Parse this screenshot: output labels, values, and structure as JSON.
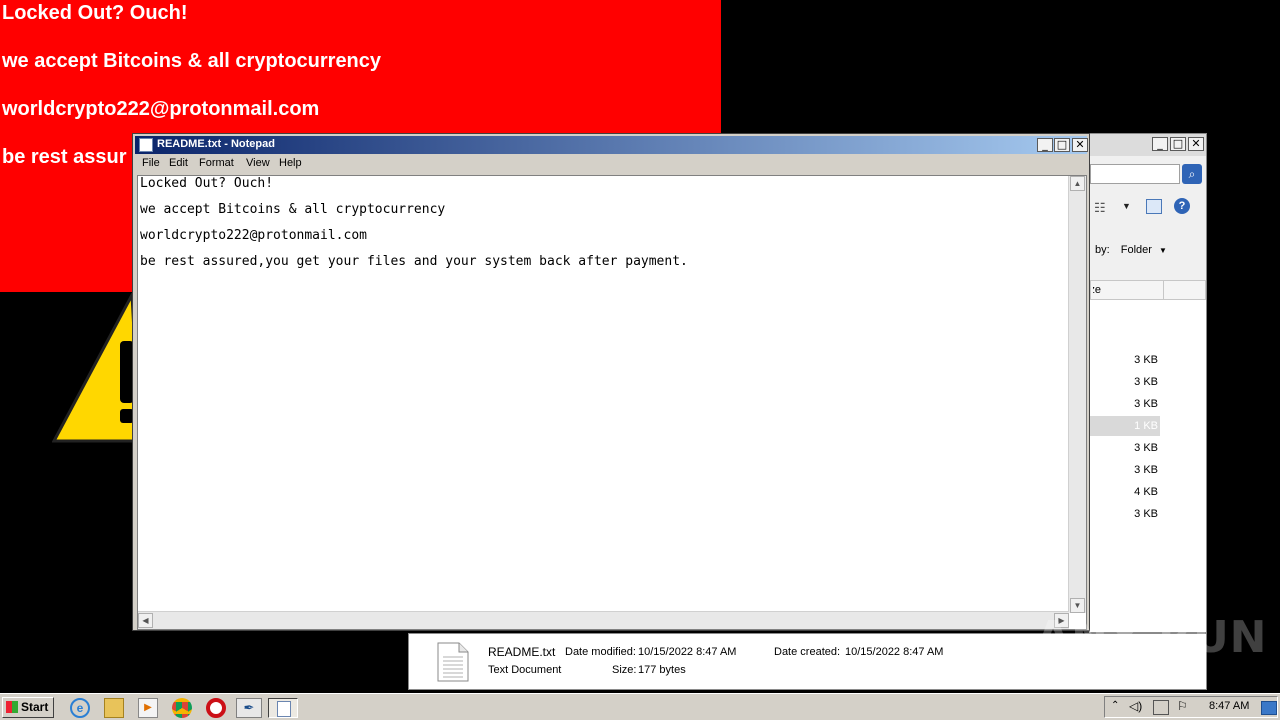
{
  "wallpaper": {
    "lines": [
      "Locked Out? Ouch!",
      "we accept Bitcoins & all cryptocurrency",
      "worldcrypto222@protonmail.com",
      "be rest assur"
    ],
    "icon": "warning-triangle-icon"
  },
  "notepad": {
    "title": "README.txt - Notepad",
    "menu": [
      "File",
      "Edit",
      "Format",
      "View",
      "Help"
    ],
    "content": [
      "Locked Out? Ouch!",
      "we accept Bitcoins & all cryptocurrency",
      "worldcrypto222@protonmail.com",
      "be rest assured,you get your files and your system back after payment."
    ]
  },
  "explorer": {
    "sort_label": "by:",
    "sort_value": "Folder",
    "column_header": "Size",
    "sizes": [
      "3 KB",
      "3 KB",
      "3 KB",
      "1 KB",
      "3 KB",
      "3 KB",
      "4 KB",
      "3 KB"
    ],
    "selected_row_index": 3
  },
  "details": {
    "file_name": "README.txt",
    "file_type": "Text Document",
    "date_modified_label": "Date modified:",
    "date_modified": "10/15/2022 8:47 AM",
    "date_created_label": "Date created:",
    "date_created": "10/15/2022 8:47 AM",
    "size_label": "Size:",
    "size": "177 bytes"
  },
  "watermark": "ANY RUN",
  "taskbar": {
    "start_label": "Start",
    "clock": "8:47 AM",
    "pinned": [
      "internet-explorer-icon",
      "explorer-folder-icon",
      "media-player-icon",
      "chrome-icon",
      "opera-icon",
      "feather-app-icon",
      "notepad-icon"
    ]
  }
}
